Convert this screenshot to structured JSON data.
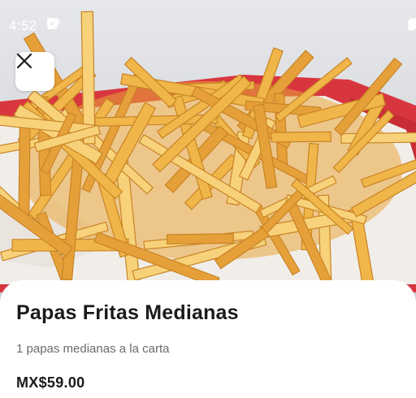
{
  "status_bar": {
    "time": "4:52",
    "left_icons": [
      "message-icon",
      "sim-card-icon",
      "link-icon",
      "shield-icon"
    ],
    "right_icons": [
      "location-icon",
      "wifi-icon",
      "battery-icon"
    ]
  },
  "hero": {
    "image": "french-fries-photo",
    "close_icon": "close-icon"
  },
  "product": {
    "title": "Papas Fritas Medianas",
    "description": "1 papas medianas a la carta",
    "price": "MX$59.00"
  },
  "colors": {
    "background": "#ffffff",
    "title": "#1a1a1a",
    "description": "#6b6b6b",
    "fries": "#f2b64a",
    "tray_red": "#d9363e"
  }
}
